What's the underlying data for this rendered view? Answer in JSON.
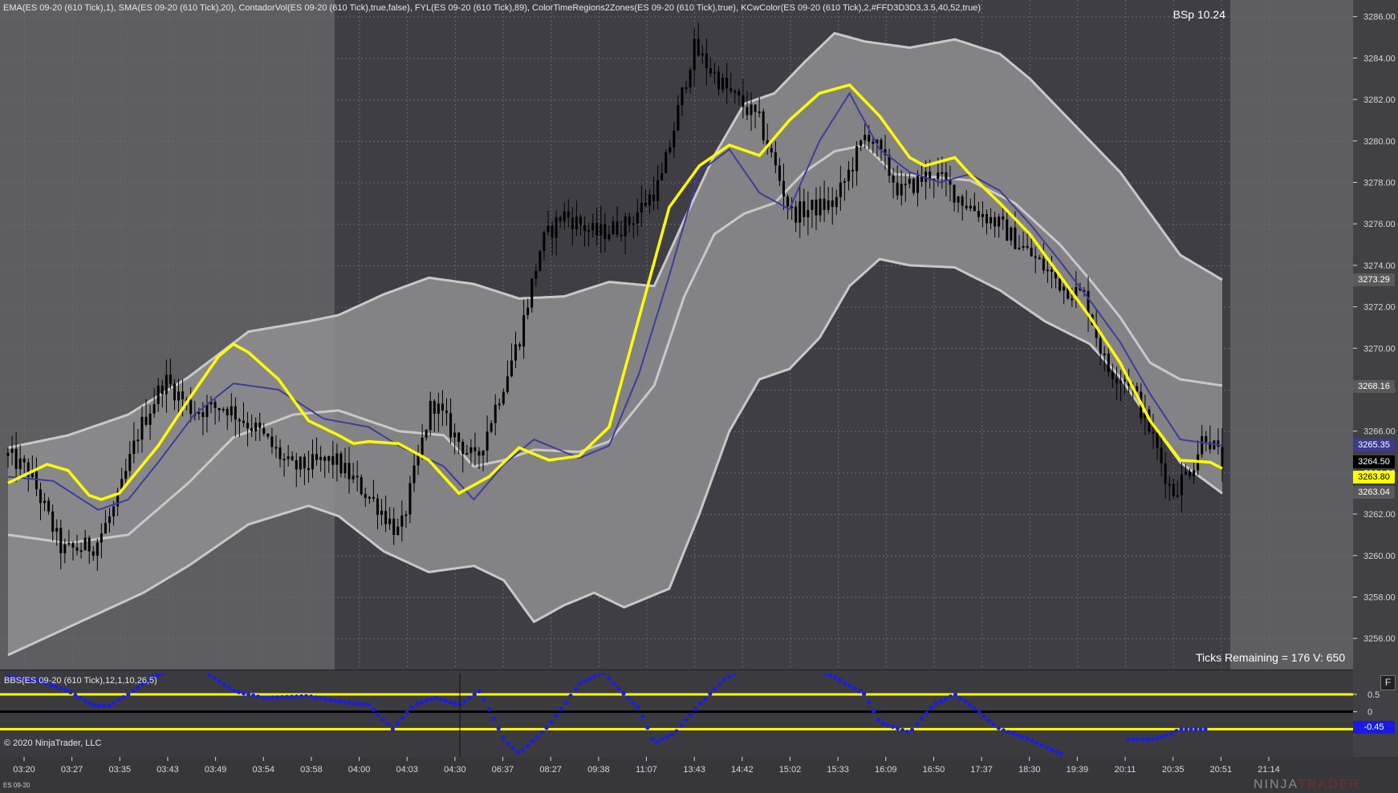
{
  "header": {
    "indicators": "EMA(ES 09-20 (610 Tick),1), SMA(ES 09-20 (610 Tick),20), ContadorVol(ES 09-20 (610 Tick),true,false), FYL(ES 09-20 (610 Tick),89), ColorTimeRegions2Zones(ES 09-20 (610 Tick),true), KCwColor(ES 09-20 (610 Tick),2,#FFD3D3D3,3.5,40,52,true)",
    "bsp": "BSp 10.24",
    "ticks_remaining": "Ticks Remaining = 176 V: 650"
  },
  "lower_panel": {
    "header": "BBS(ES 09-20 (610 Tick),12,1,10,26,5)",
    "copyright": "© 2020 NinjaTrader, LLC",
    "f_button": "F"
  },
  "footer": {
    "instrument": "ES 09-20",
    "brand_part1": "NINJA",
    "brand_part2": "TRADER"
  },
  "price_boxes": [
    {
      "label": "3273.29",
      "value": 3273.29,
      "bg": "#5a5a5a",
      "fg": "#ffffff"
    },
    {
      "label": "3268.16",
      "value": 3268.16,
      "bg": "#5a5a5a",
      "fg": "#ffffff"
    },
    {
      "label": "3265.35",
      "value": 3265.35,
      "bg": "#3b3b8f",
      "fg": "#ffffff"
    },
    {
      "label": "3264.50",
      "value": 3264.5,
      "bg": "#000000",
      "fg": "#ffffff"
    },
    {
      "label": "3263.80",
      "value": 3263.8,
      "bg": "#ffff00",
      "fg": "#000000"
    },
    {
      "label": "3263.04",
      "value": 3263.04,
      "bg": "#5a5a5a",
      "fg": "#ffffff"
    }
  ],
  "osc_box": {
    "label": "-0.45",
    "value": -0.45,
    "bg": "#1a1ae0",
    "fg": "#ffffff"
  },
  "colors": {
    "background_zone": "#5e5e61",
    "dark_zone": "#3e3e44",
    "channel_fill": "#8f8f92",
    "channel_border": "#c8c8c8",
    "ema_line": "#ffff00",
    "sma_line": "#3d3d99",
    "candles": "#000000",
    "osc_dots": "#1a1aee",
    "osc_levels": "#ffff00"
  },
  "chart_data": {
    "type": "candlestick",
    "instrument": "ES 09-20",
    "y_axis": {
      "ticks": [
        3256,
        3258,
        3260,
        3262,
        3264,
        3266,
        3268,
        3270,
        3272,
        3274,
        3276,
        3278,
        3280,
        3282,
        3284,
        3286
      ],
      "tick_labels": [
        "3256.00",
        "3258.00",
        "3260.00",
        "3262.00",
        "3264.00",
        "3266.00",
        "3268.00",
        "3270.00",
        "3272.00",
        "3274.00",
        "3276.00",
        "3278.00",
        "3280.00",
        "3282.00",
        "3284.00",
        "3286.00"
      ],
      "range": [
        3254.5,
        3286.8
      ]
    },
    "x_axis": {
      "tick_labels": [
        "03:20",
        "03:27",
        "03:35",
        "03:43",
        "03:49",
        "03:54",
        "03:58",
        "04:00",
        "04:03",
        "04:30",
        "06:37",
        "08:27",
        "09:38",
        "11:07",
        "13:43",
        "14:42",
        "15:02",
        "15:33",
        "16:09",
        "16:50",
        "17:37",
        "18:30",
        "19:39",
        "20:11",
        "20:35",
        "20:51",
        "21:14"
      ]
    },
    "n_bars": 300,
    "closes_anchor": [
      [
        0,
        3264.8
      ],
      [
        10,
        3264.0
      ],
      [
        25,
        3260.2
      ],
      [
        40,
        3260.5
      ],
      [
        50,
        3262.5
      ],
      [
        60,
        3266.0
      ],
      [
        72,
        3268.5
      ],
      [
        85,
        3267.0
      ],
      [
        100,
        3267.2
      ],
      [
        115,
        3266.0
      ],
      [
        130,
        3264.2
      ],
      [
        150,
        3264.6
      ],
      [
        170,
        3262.4
      ],
      [
        180,
        3261.0
      ],
      [
        195,
        3267.5
      ],
      [
        205,
        3265.8
      ],
      [
        215,
        3264.5
      ],
      [
        225,
        3267.5
      ],
      [
        235,
        3270.5
      ],
      [
        245,
        3275.0
      ],
      [
        255,
        3276.5
      ],
      [
        270,
        3275.5
      ],
      [
        285,
        3276.0
      ],
      [
        300,
        3278.0
      ],
      [
        315,
        3284.5
      ],
      [
        330,
        3282.5
      ],
      [
        345,
        3281.0
      ],
      [
        360,
        3276.5
      ],
      [
        380,
        3277.0
      ],
      [
        395,
        3280.5
      ],
      [
        410,
        3277.5
      ],
      [
        425,
        3278.5
      ],
      [
        440,
        3277.0
      ],
      [
        455,
        3276.0
      ],
      [
        470,
        3274.5
      ],
      [
        485,
        3273.0
      ],
      [
        495,
        3272.5
      ],
      [
        505,
        3269.0
      ],
      [
        515,
        3268.5
      ],
      [
        525,
        3266.0
      ],
      [
        535,
        3263.0
      ],
      [
        545,
        3264.5
      ],
      [
        550,
        3266.0
      ],
      [
        558,
        3264.5
      ]
    ],
    "ema": [
      [
        0,
        3263.5
      ],
      [
        13,
        3264.4
      ],
      [
        20,
        3264.1
      ],
      [
        27,
        3262.9
      ],
      [
        31,
        3262.7
      ],
      [
        37,
        3263.0
      ],
      [
        50,
        3265.3
      ],
      [
        60,
        3267.5
      ],
      [
        70,
        3269.6
      ],
      [
        75,
        3270.2
      ],
      [
        80,
        3269.8
      ],
      [
        90,
        3268.5
      ],
      [
        100,
        3266.5
      ],
      [
        110,
        3265.8
      ],
      [
        115,
        3265.4
      ],
      [
        120,
        3265.5
      ],
      [
        130,
        3265.4
      ],
      [
        140,
        3264.6
      ],
      [
        150,
        3263.0
      ],
      [
        160,
        3263.8
      ],
      [
        170,
        3265.2
      ],
      [
        180,
        3264.6
      ],
      [
        190,
        3264.8
      ],
      [
        200,
        3266.2
      ],
      [
        210,
        3271.5
      ],
      [
        220,
        3276.8
      ],
      [
        230,
        3278.8
      ],
      [
        240,
        3279.8
      ],
      [
        250,
        3279.3
      ],
      [
        260,
        3281.0
      ],
      [
        270,
        3282.3
      ],
      [
        280,
        3282.7
      ],
      [
        290,
        3281.2
      ],
      [
        300,
        3279.2
      ],
      [
        305,
        3278.8
      ],
      [
        315,
        3279.2
      ],
      [
        320,
        3278.4
      ],
      [
        330,
        3277.0
      ],
      [
        340,
        3275.5
      ],
      [
        350,
        3273.5
      ],
      [
        360,
        3271.5
      ],
      [
        370,
        3269.3
      ],
      [
        380,
        3266.5
      ],
      [
        390,
        3264.6
      ],
      [
        400,
        3264.5
      ],
      [
        404,
        3264.2
      ]
    ],
    "sma": [
      [
        0,
        3263.8
      ],
      [
        15,
        3263.6
      ],
      [
        30,
        3262.2
      ],
      [
        40,
        3262.7
      ],
      [
        50,
        3264.5
      ],
      [
        62,
        3266.8
      ],
      [
        75,
        3268.3
      ],
      [
        90,
        3268.0
      ],
      [
        105,
        3266.6
      ],
      [
        120,
        3266.2
      ],
      [
        130,
        3265.3
      ],
      [
        145,
        3264.3
      ],
      [
        155,
        3262.7
      ],
      [
        165,
        3264.4
      ],
      [
        175,
        3265.6
      ],
      [
        190,
        3264.7
      ],
      [
        200,
        3265.3
      ],
      [
        210,
        3268.8
      ],
      [
        220,
        3273.5
      ],
      [
        230,
        3278.5
      ],
      [
        240,
        3279.6
      ],
      [
        250,
        3277.5
      ],
      [
        260,
        3276.7
      ],
      [
        270,
        3280.0
      ],
      [
        280,
        3282.3
      ],
      [
        290,
        3279.6
      ],
      [
        300,
        3278.5
      ],
      [
        310,
        3278.0
      ],
      [
        320,
        3278.4
      ],
      [
        330,
        3277.6
      ],
      [
        340,
        3276.0
      ],
      [
        350,
        3274.2
      ],
      [
        360,
        3272.3
      ],
      [
        370,
        3270.3
      ],
      [
        380,
        3267.8
      ],
      [
        390,
        3265.6
      ],
      [
        400,
        3265.4
      ],
      [
        404,
        3265.3
      ]
    ],
    "channel_upper": [
      [
        0,
        3265.2
      ],
      [
        20,
        3265.8
      ],
      [
        40,
        3266.8
      ],
      [
        60,
        3268.6
      ],
      [
        80,
        3270.8
      ],
      [
        100,
        3271.3
      ],
      [
        110,
        3271.6
      ],
      [
        125,
        3272.6
      ],
      [
        140,
        3273.4
      ],
      [
        155,
        3273.1
      ],
      [
        170,
        3272.4
      ],
      [
        185,
        3272.5
      ],
      [
        200,
        3273.2
      ],
      [
        215,
        3273.0
      ],
      [
        225,
        3276.2
      ],
      [
        235,
        3279.3
      ],
      [
        245,
        3281.8
      ],
      [
        255,
        3282.3
      ],
      [
        265,
        3283.8
      ],
      [
        275,
        3285.2
      ],
      [
        285,
        3284.8
      ],
      [
        300,
        3284.5
      ],
      [
        315,
        3284.9
      ],
      [
        330,
        3284.2
      ],
      [
        340,
        3283.0
      ],
      [
        350,
        3281.5
      ],
      [
        360,
        3280.0
      ],
      [
        370,
        3278.5
      ],
      [
        380,
        3276.5
      ],
      [
        390,
        3274.5
      ],
      [
        404,
        3273.3
      ]
    ],
    "channel_lower": [
      [
        0,
        3255.2
      ],
      [
        15,
        3256.2
      ],
      [
        30,
        3257.2
      ],
      [
        45,
        3258.2
      ],
      [
        60,
        3259.5
      ],
      [
        80,
        3261.5
      ],
      [
        100,
        3262.4
      ],
      [
        110,
        3261.9
      ],
      [
        125,
        3260.2
      ],
      [
        140,
        3259.2
      ],
      [
        155,
        3259.5
      ],
      [
        165,
        3258.8
      ],
      [
        175,
        3256.8
      ],
      [
        185,
        3257.6
      ],
      [
        195,
        3258.2
      ],
      [
        205,
        3257.5
      ],
      [
        220,
        3258.4
      ],
      [
        230,
        3262.0
      ],
      [
        240,
        3266.0
      ],
      [
        250,
        3268.5
      ],
      [
        260,
        3269.0
      ],
      [
        270,
        3270.5
      ],
      [
        280,
        3273.0
      ],
      [
        290,
        3274.3
      ],
      [
        300,
        3274.0
      ],
      [
        315,
        3273.9
      ],
      [
        330,
        3272.8
      ],
      [
        345,
        3271.3
      ],
      [
        360,
        3270.2
      ],
      [
        370,
        3268.6
      ],
      [
        380,
        3266.5
      ],
      [
        390,
        3264.5
      ],
      [
        404,
        3263.0
      ]
    ],
    "channel_mid_upper": [
      [
        0,
        3261.0
      ],
      [
        20,
        3260.6
      ],
      [
        40,
        3261.0
      ],
      [
        60,
        3263.5
      ],
      [
        75,
        3265.7
      ],
      [
        95,
        3266.8
      ],
      [
        110,
        3267.0
      ],
      [
        120,
        3266.5
      ],
      [
        130,
        3266.0
      ],
      [
        145,
        3265.8
      ],
      [
        155,
        3264.3
      ],
      [
        165,
        3264.6
      ],
      [
        175,
        3265.1
      ],
      [
        190,
        3265.0
      ],
      [
        200,
        3265.5
      ],
      [
        215,
        3268.2
      ],
      [
        225,
        3272.5
      ],
      [
        235,
        3275.5
      ],
      [
        245,
        3276.5
      ],
      [
        255,
        3277.0
      ],
      [
        265,
        3278.5
      ],
      [
        275,
        3279.5
      ],
      [
        285,
        3279.8
      ],
      [
        295,
        3278.4
      ],
      [
        305,
        3278.3
      ],
      [
        320,
        3278.1
      ],
      [
        335,
        3277.0
      ],
      [
        350,
        3275.0
      ],
      [
        360,
        3273.3
      ],
      [
        370,
        3271.5
      ],
      [
        380,
        3269.3
      ],
      [
        390,
        3268.5
      ],
      [
        404,
        3268.2
      ]
    ],
    "oscillator": {
      "levels": [
        0.5,
        0,
        -0.5
      ],
      "tick_labels": [
        "0.5",
        "0"
      ],
      "range": [
        -1.3,
        1.1
      ],
      "anchors": [
        [
          0,
          1.0
        ],
        [
          10,
          0.9
        ],
        [
          20,
          0.6
        ],
        [
          28,
          0.2
        ],
        [
          33,
          0.15
        ],
        [
          40,
          0.5
        ],
        [
          48,
          1.0
        ],
        [
          55,
          1.2
        ],
        [
          65,
          1.2
        ],
        [
          75,
          0.6
        ],
        [
          85,
          0.4
        ],
        [
          100,
          0.45
        ],
        [
          110,
          0.3
        ],
        [
          120,
          0.2
        ],
        [
          128,
          -0.5
        ],
        [
          135,
          0.2
        ],
        [
          142,
          0.4
        ],
        [
          150,
          0.2
        ],
        [
          157,
          0.6
        ],
        [
          165,
          -0.8
        ],
        [
          170,
          -1.2
        ],
        [
          180,
          -0.4
        ],
        [
          190,
          0.8
        ],
        [
          198,
          1.15
        ],
        [
          205,
          0.5
        ],
        [
          210,
          0.1
        ],
        [
          215,
          -0.9
        ],
        [
          222,
          -0.6
        ],
        [
          230,
          0.2
        ],
        [
          238,
          0.9
        ],
        [
          245,
          1.3
        ],
        [
          255,
          1.4
        ],
        [
          265,
          1.35
        ],
        [
          275,
          1.0
        ],
        [
          285,
          0.5
        ],
        [
          290,
          -0.3
        ],
        [
          300,
          -0.6
        ],
        [
          308,
          0.2
        ],
        [
          315,
          0.5
        ],
        [
          320,
          0.2
        ],
        [
          330,
          -0.5
        ],
        [
          340,
          -0.8
        ],
        [
          350,
          -1.2
        ],
        [
          360,
          -1.1
        ],
        [
          368,
          -0.8
        ],
        [
          372,
          -0.8
        ],
        [
          380,
          -0.8
        ],
        [
          385,
          -0.7
        ],
        [
          390,
          -0.5
        ],
        [
          400,
          -0.5
        ]
      ]
    }
  }
}
